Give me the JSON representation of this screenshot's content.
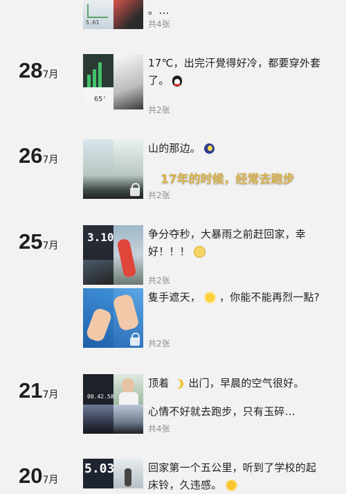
{
  "feed": {
    "top_post": {
      "text": "。…",
      "count": "共4张",
      "thumb_label": "5.61"
    },
    "groups": [
      {
        "day": "28",
        "month": "7月",
        "posts": [
          {
            "text": "17℃，出完汗覺得好冷，都要穿外套了。",
            "emoji": "penguin-emoji",
            "count": "共2张",
            "thumb_label": "65'"
          }
        ]
      },
      {
        "day": "26",
        "month": "7月",
        "posts": [
          {
            "text": "山的那边。",
            "emoji": "moon-emoji",
            "count": "共2张"
          }
        ]
      },
      {
        "day": "25",
        "month": "7月",
        "posts": [
          {
            "text": "争分夺秒，大暴雨之前赶回家，幸好！！！",
            "emoji": "dizzy-face-emoji",
            "count": "共2张",
            "thumb_label": "3.10"
          },
          {
            "text": "隻手遮天，",
            "text_after": "，你能不能再烈一點?",
            "emoji": "sun-emoji",
            "count": "共2张"
          }
        ]
      },
      {
        "day": "21",
        "month": "7月",
        "posts": [
          {
            "text": "顶着",
            "text_after": "出门，早晨的空气很好。",
            "text_line2": "心情不好就去跑步，只有玉碎…",
            "emoji": "crescent-moon-emoji",
            "count": "共4张",
            "thumb_label": "00.42.58"
          }
        ]
      },
      {
        "day": "20",
        "month": "7月",
        "posts": [
          {
            "text": "回家第一个五公里，听到了学校的起床铃，久违感。",
            "emoji": "sun-face-emoji",
            "thumb_label": "5.03"
          }
        ]
      }
    ],
    "overlay_caption": "17年的时候，经常去跑步",
    "colors": {
      "background": "#f2f2f2",
      "caption": "#d9b24a",
      "count_text": "#8c8c8c"
    }
  }
}
